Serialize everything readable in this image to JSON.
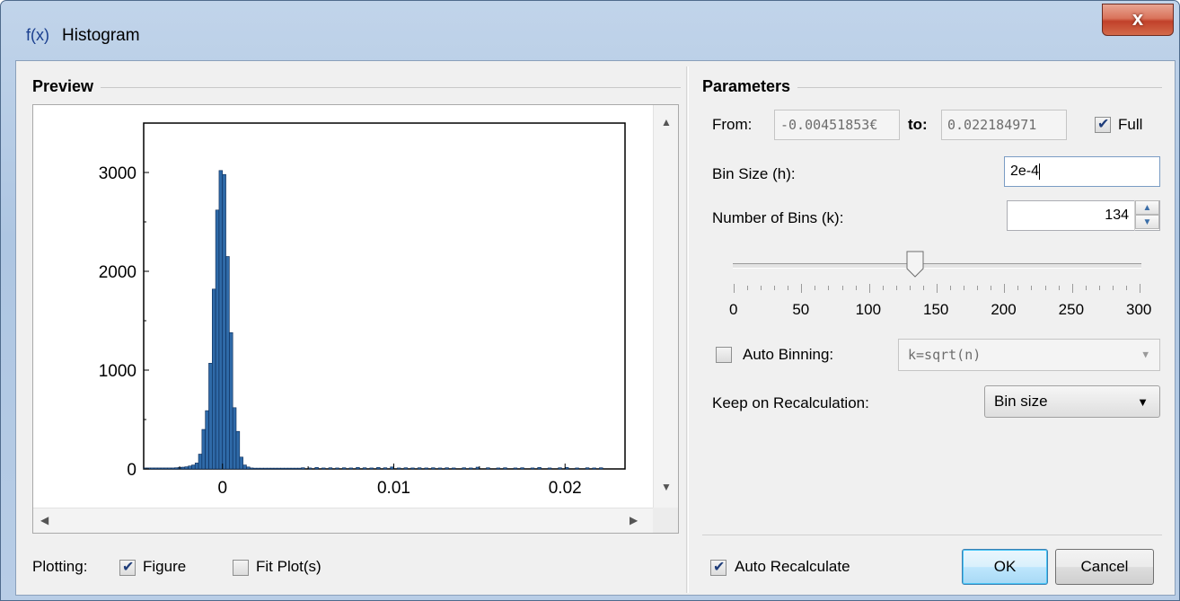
{
  "window": {
    "app_icon": "f(x)",
    "title": "Histogram",
    "close_label": "x"
  },
  "preview": {
    "group_title": "Preview",
    "plotting_label": "Plotting:",
    "figure_label": "Figure",
    "figure_checked": true,
    "fit_label": "Fit Plot(s)",
    "fit_checked": false
  },
  "parameters": {
    "group_title": "Parameters",
    "from_label": "From:",
    "from_value": "-0.00451853€",
    "to_label": "to:",
    "to_value": "0.022184971",
    "full_label": "Full",
    "full_checked": true,
    "bin_size_label": "Bin Size (h):",
    "bin_size_value": "2e-4",
    "num_bins_label": "Number of Bins (k):",
    "num_bins_value": "134",
    "slider": {
      "min": 0,
      "max": 300,
      "value": 134,
      "tick_labels": [
        "0",
        "50",
        "100",
        "150",
        "200",
        "250",
        "300"
      ]
    },
    "auto_binning_label": "Auto Binning:",
    "auto_binning_checked": false,
    "auto_binning_value": "k=sqrt(n)",
    "keep_label": "Keep on Recalculation:",
    "keep_value": "Bin size"
  },
  "footer": {
    "auto_recalc_label": "Auto Recalculate",
    "auto_recalc_checked": true,
    "ok_label": "OK",
    "cancel_label": "Cancel"
  },
  "chart_data": {
    "type": "bar",
    "title": "",
    "xlabel": "",
    "ylabel": "",
    "xlim": [
      -0.0046,
      0.0235
    ],
    "ylim": [
      0,
      3500
    ],
    "x_ticks": [
      0,
      0.01,
      0.02
    ],
    "x_tick_labels": [
      "0",
      "0.01",
      "0.02"
    ],
    "y_ticks": [
      0,
      1000,
      2000,
      3000
    ],
    "y_tick_labels": [
      "0",
      "1000",
      "2000",
      "3000"
    ],
    "bin_width": 0.0002,
    "bars": [
      {
        "x": -0.0045,
        "y": 10
      },
      {
        "x": -0.0043,
        "y": 10
      },
      {
        "x": -0.0041,
        "y": 10
      },
      {
        "x": -0.0039,
        "y": 10
      },
      {
        "x": -0.0037,
        "y": 10
      },
      {
        "x": -0.0035,
        "y": 10
      },
      {
        "x": -0.0033,
        "y": 10
      },
      {
        "x": -0.0031,
        "y": 10
      },
      {
        "x": -0.0029,
        "y": 10
      },
      {
        "x": -0.0027,
        "y": 12
      },
      {
        "x": -0.0025,
        "y": 15
      },
      {
        "x": -0.0023,
        "y": 18
      },
      {
        "x": -0.0021,
        "y": 22
      },
      {
        "x": -0.0019,
        "y": 30
      },
      {
        "x": -0.0017,
        "y": 40
      },
      {
        "x": -0.0015,
        "y": 60
      },
      {
        "x": -0.0013,
        "y": 150
      },
      {
        "x": -0.0011,
        "y": 400
      },
      {
        "x": -0.0009,
        "y": 590
      },
      {
        "x": -0.0007,
        "y": 1070
      },
      {
        "x": -0.0005,
        "y": 1820
      },
      {
        "x": -0.0003,
        "y": 2620
      },
      {
        "x": -0.0001,
        "y": 3020
      },
      {
        "x": 0.0001,
        "y": 2980
      },
      {
        "x": 0.0003,
        "y": 2150
      },
      {
        "x": 0.0005,
        "y": 1380
      },
      {
        "x": 0.0007,
        "y": 620
      },
      {
        "x": 0.0009,
        "y": 380
      },
      {
        "x": 0.0011,
        "y": 120
      },
      {
        "x": 0.0013,
        "y": 40
      },
      {
        "x": 0.0015,
        "y": 20
      },
      {
        "x": 0.0017,
        "y": 10
      },
      {
        "x": 0.0019,
        "y": 8
      },
      {
        "x": 0.0021,
        "y": 8
      },
      {
        "x": 0.0023,
        "y": 8
      },
      {
        "x": 0.0025,
        "y": 8
      },
      {
        "x": 0.0027,
        "y": 8
      },
      {
        "x": 0.0029,
        "y": 8
      },
      {
        "x": 0.0031,
        "y": 8
      },
      {
        "x": 0.0033,
        "y": 8
      },
      {
        "x": 0.0035,
        "y": 8
      },
      {
        "x": 0.0037,
        "y": 8
      },
      {
        "x": 0.0039,
        "y": 8
      },
      {
        "x": 0.0041,
        "y": 8
      },
      {
        "x": 0.0043,
        "y": 8
      },
      {
        "x": 0.0045,
        "y": 8
      },
      {
        "x": 0.0047,
        "y": 12
      },
      {
        "x": 0.0051,
        "y": 10
      },
      {
        "x": 0.0055,
        "y": 15
      },
      {
        "x": 0.0059,
        "y": 10
      },
      {
        "x": 0.0063,
        "y": 12
      },
      {
        "x": 0.0067,
        "y": 10
      },
      {
        "x": 0.0071,
        "y": 12
      },
      {
        "x": 0.0075,
        "y": 10
      },
      {
        "x": 0.0079,
        "y": 15
      },
      {
        "x": 0.0083,
        "y": 12
      },
      {
        "x": 0.0087,
        "y": 10
      },
      {
        "x": 0.0091,
        "y": 15
      },
      {
        "x": 0.0095,
        "y": 12
      },
      {
        "x": 0.0099,
        "y": 20
      },
      {
        "x": 0.0103,
        "y": 10
      },
      {
        "x": 0.0107,
        "y": 12
      },
      {
        "x": 0.0111,
        "y": 10
      },
      {
        "x": 0.0115,
        "y": 12
      },
      {
        "x": 0.0119,
        "y": 10
      },
      {
        "x": 0.0123,
        "y": 12
      },
      {
        "x": 0.0127,
        "y": 10
      },
      {
        "x": 0.0131,
        "y": 12
      },
      {
        "x": 0.0135,
        "y": 10
      },
      {
        "x": 0.0141,
        "y": 12
      },
      {
        "x": 0.0145,
        "y": 10
      },
      {
        "x": 0.0149,
        "y": 18
      },
      {
        "x": 0.0155,
        "y": 12
      },
      {
        "x": 0.0161,
        "y": 10
      },
      {
        "x": 0.0165,
        "y": 12
      },
      {
        "x": 0.0171,
        "y": 10
      },
      {
        "x": 0.0175,
        "y": 12
      },
      {
        "x": 0.0181,
        "y": 10
      },
      {
        "x": 0.0185,
        "y": 15
      },
      {
        "x": 0.0191,
        "y": 10
      },
      {
        "x": 0.0197,
        "y": 12
      },
      {
        "x": 0.0201,
        "y": 15
      },
      {
        "x": 0.0207,
        "y": 10
      },
      {
        "x": 0.0213,
        "y": 12
      },
      {
        "x": 0.0217,
        "y": 10
      },
      {
        "x": 0.0221,
        "y": 12
      }
    ],
    "bar_color": "#2f6aa8",
    "bar_edge": "#0a2a55",
    "grid": false,
    "legend": "none"
  }
}
